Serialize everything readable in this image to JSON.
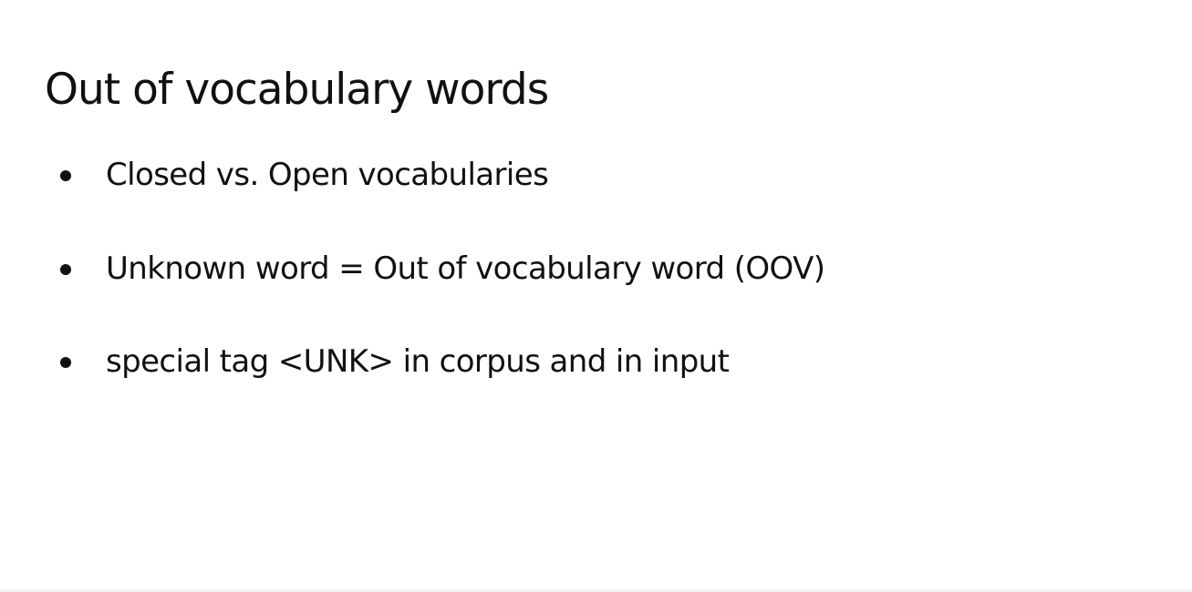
{
  "slide": {
    "title": "Out of vocabulary words",
    "bullets": [
      {
        "text": "Closed vs. Open vocabularies"
      },
      {
        "text": "Unknown word = Out of vocabulary word (OOV)"
      },
      {
        "text": "special tag <UNK> in corpus and in input"
      }
    ]
  }
}
